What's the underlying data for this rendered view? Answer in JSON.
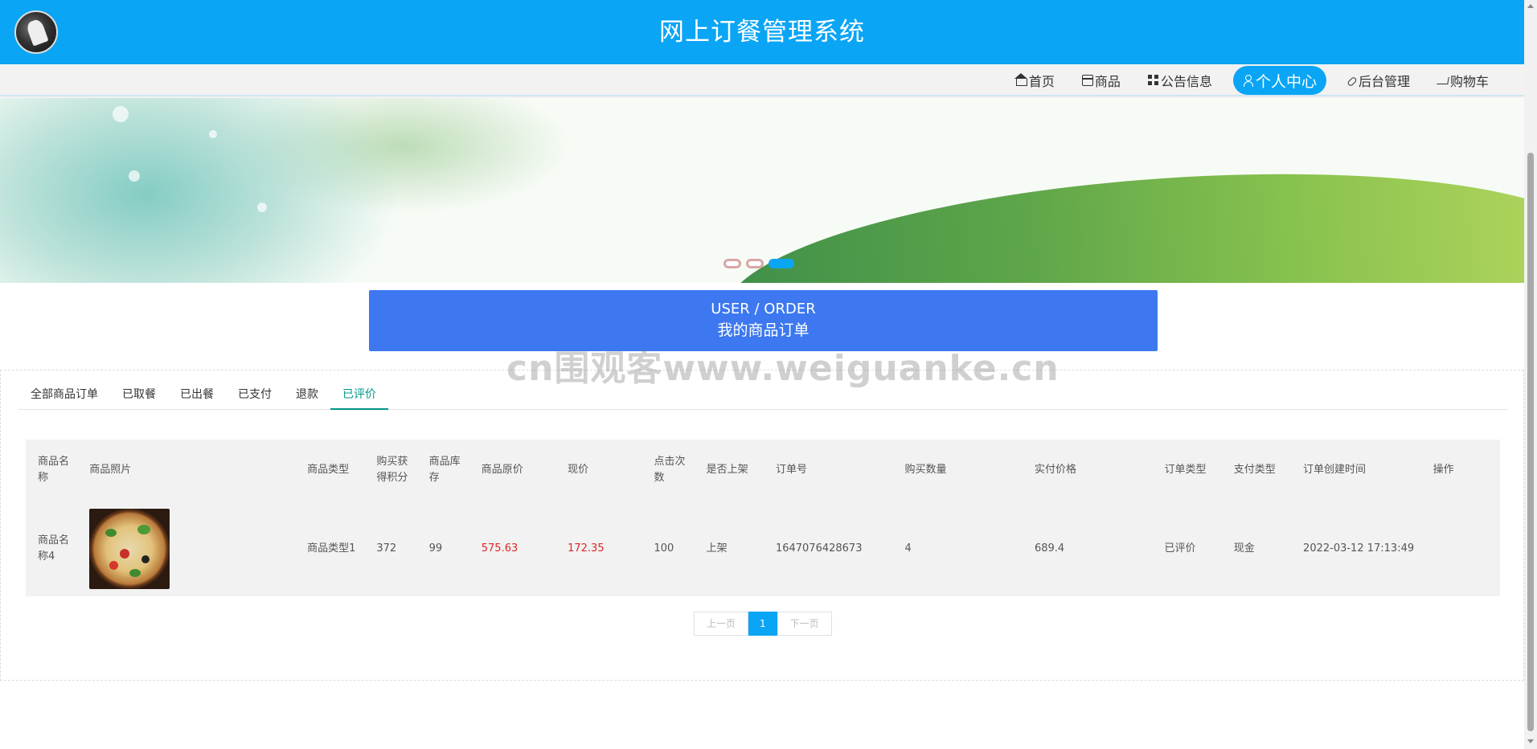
{
  "header": {
    "title": "网上订餐管理系统",
    "logo": "avatar-logo"
  },
  "nav": {
    "items": [
      {
        "label": "首页",
        "icon": "home-icon"
      },
      {
        "label": "商品",
        "icon": "calendar-icon"
      },
      {
        "label": "公告信息",
        "icon": "grid-icon"
      },
      {
        "label": "个人中心",
        "icon": "user-icon",
        "active": true
      },
      {
        "label": "后台管理",
        "icon": "link-icon"
      },
      {
        "label": "购物车",
        "icon": "cart-icon"
      }
    ]
  },
  "banner": {
    "slides": 3,
    "active_slide": 3
  },
  "order_header": {
    "en": "USER / ORDER",
    "cn": "我的商品订单"
  },
  "tabs": [
    {
      "label": "全部商品订单"
    },
    {
      "label": "已取餐"
    },
    {
      "label": "已出餐"
    },
    {
      "label": "已支付"
    },
    {
      "label": "退款"
    },
    {
      "label": "已评价",
      "active": true
    }
  ],
  "table": {
    "columns": [
      "商品名称",
      "商品照片",
      "商品类型",
      "购买获得积分",
      "商品库存",
      "商品原价",
      "现价",
      "点击次数",
      "是否上架",
      "订单号",
      "购买数量",
      "实付价格",
      "订单类型",
      "支付类型",
      "订单创建时间",
      "操作"
    ],
    "rows": [
      {
        "name": "商品名称4",
        "photo": "pizza-image",
        "type": "商品类型1",
        "points": "372",
        "stock": "99",
        "original_price": "575.63",
        "current_price": "172.35",
        "clicks": "100",
        "on_shelf": "上架",
        "order_no": "1647076428673",
        "quantity": "4",
        "paid_price": "689.4",
        "order_type": "已评价",
        "pay_type": "现金",
        "created_at": "2022-03-12 17:13:49",
        "action": ""
      }
    ]
  },
  "pager": {
    "prev": "上一页",
    "current": "1",
    "next": "下一页"
  },
  "watermark": "cn围观客www.weiguanke.cn",
  "colors": {
    "primary": "#0aa5f5",
    "order_header": "#3d78f0",
    "tab_active": "#009688",
    "price": "#e02424"
  }
}
